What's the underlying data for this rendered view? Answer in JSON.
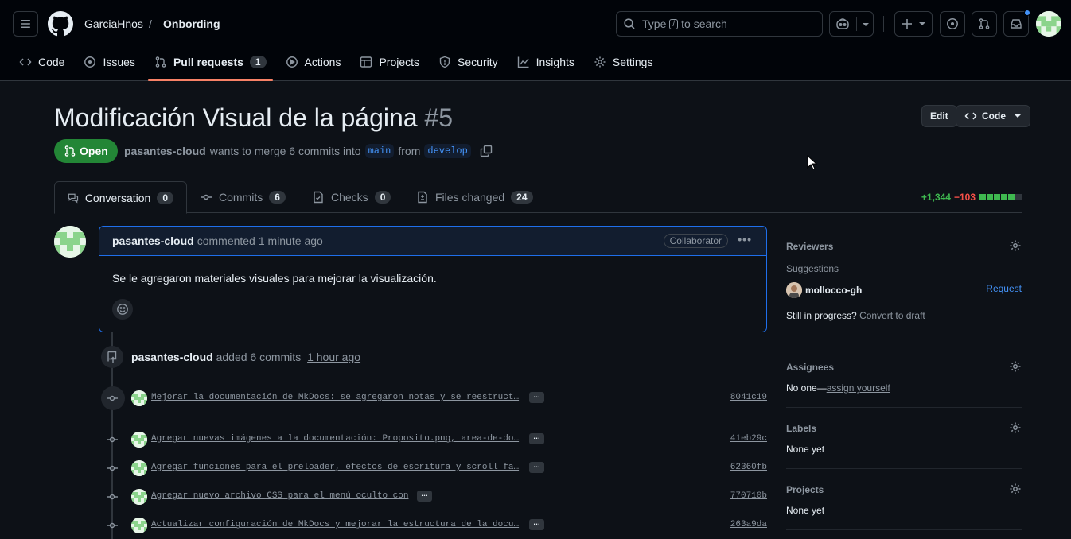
{
  "header": {
    "owner": "GarciaHnos",
    "separator": "/",
    "repo": "Onbording",
    "search_prefix": "Type",
    "search_key": "/",
    "search_suffix": "to search"
  },
  "nav": [
    {
      "label": "Code",
      "icon": "code-icon"
    },
    {
      "label": "Issues",
      "icon": "issue-opened-icon"
    },
    {
      "label": "Pull requests",
      "icon": "git-pull-request-icon",
      "count": "1",
      "selected": true
    },
    {
      "label": "Actions",
      "icon": "play-icon"
    },
    {
      "label": "Projects",
      "icon": "table-icon"
    },
    {
      "label": "Security",
      "icon": "shield-icon"
    },
    {
      "label": "Insights",
      "icon": "graph-icon"
    },
    {
      "label": "Settings",
      "icon": "gear-icon"
    }
  ],
  "pr": {
    "title": "Modificación Visual de la página",
    "number": "#5",
    "edit_label": "Edit",
    "code_label": "Code",
    "status": "Open",
    "author": "pasantes-cloud",
    "merge_text": "wants to merge 6 commits into",
    "base_branch": "main",
    "from_text": "from",
    "head_branch": "develop"
  },
  "pr_tabs": [
    {
      "label": "Conversation",
      "count": "0",
      "icon": "comment-discussion-icon"
    },
    {
      "label": "Commits",
      "count": "6",
      "icon": "git-commit-icon"
    },
    {
      "label": "Checks",
      "count": "0",
      "icon": "checklist-icon"
    },
    {
      "label": "Files changed",
      "count": "24",
      "icon": "file-diff-icon"
    }
  ],
  "diffstat": {
    "additions": "+1,344",
    "deletions": "−103"
  },
  "comment": {
    "author": "pasantes-cloud",
    "action": "commented",
    "time": "1 minute ago",
    "role": "Collaborator",
    "body": "Se le agregaron materiales visuales para mejorar la visualización."
  },
  "commits_event": {
    "author": "pasantes-cloud",
    "text": "added 6 commits",
    "time": "1 hour ago"
  },
  "commits": [
    {
      "message": "Mejorar la documentación de MkDocs: se agregaron notas y se reestruct…",
      "sha": "8041c19"
    },
    {
      "message": "Agregar nuevas imágenes a la documentación: Proposito.png, area-de-do…",
      "sha": "41eb29c"
    },
    {
      "message": "Agregar funciones para el preloader, efectos de escritura y scroll fa…",
      "sha": "62360fb"
    },
    {
      "message": "Agregar nuevo archivo CSS para el menú oculto con",
      "sha": "770710b"
    },
    {
      "message": "Actualizar configuración de MkDocs y mejorar la estructura de la docu…",
      "sha": "263a9da"
    }
  ],
  "sidebar": {
    "reviewers": {
      "heading": "Reviewers",
      "suggestions": "Suggestions",
      "user": "mollocco-gh",
      "request": "Request",
      "progress": "Still in progress?",
      "draft_link": "Convert to draft"
    },
    "assignees": {
      "heading": "Assignees",
      "none": "No one—",
      "link": "assign yourself"
    },
    "labels": {
      "heading": "Labels",
      "value": "None yet"
    },
    "projects": {
      "heading": "Projects",
      "value": "None yet"
    }
  },
  "colors": {
    "accent_green": "#238636",
    "link_blue": "#4493f8",
    "tab_underline": "#f78166",
    "additions": "#3fb950",
    "deletions": "#f85149"
  }
}
